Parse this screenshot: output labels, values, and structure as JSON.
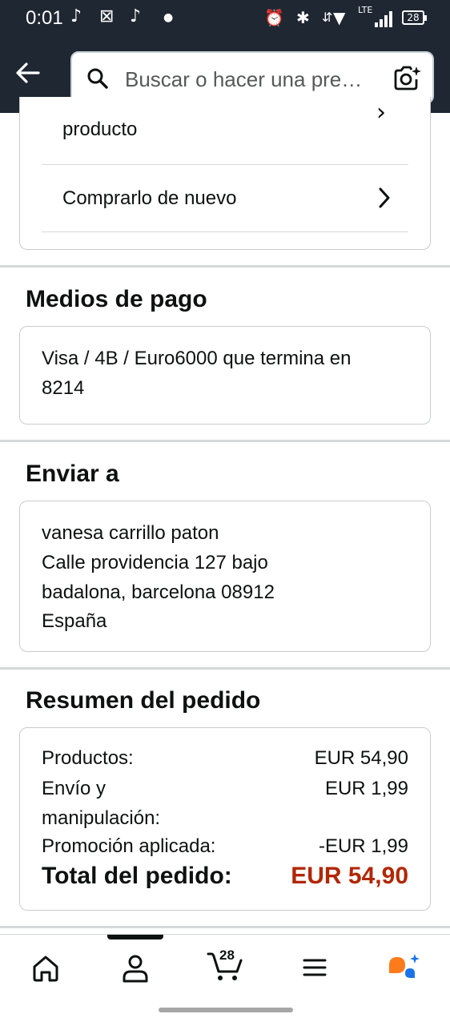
{
  "status_bar": {
    "time": "0:01",
    "network": "LTE",
    "battery": "28"
  },
  "search": {
    "placeholder": "Buscar o hacer una pre…"
  },
  "order_actions": {
    "partial_item_label": "producto",
    "buy_again_label": "Comprarlo de nuevo"
  },
  "payment": {
    "title": "Medios de pago",
    "method_line1": "Visa / 4B / Euro6000 que termina en",
    "method_line2": "8214"
  },
  "shipping": {
    "title": "Enviar a",
    "name": "vanesa carrillo paton",
    "street": "Calle providencia 127 bajo",
    "city": "badalona, barcelona 08912",
    "country": "España"
  },
  "summary": {
    "title": "Resumen del pedido",
    "products_label": "Productos:",
    "products_value": "EUR 54,90",
    "shipping_label_1": "Envío y",
    "shipping_label_2": "manipulación:",
    "shipping_value": "EUR 1,99",
    "promo_label": "Promoción aplicada:",
    "promo_value": "-EUR 1,99",
    "total_label": "Total del pedido:",
    "total_value": "EUR 54,90",
    "total_color": "#B12704"
  },
  "bottom_nav": {
    "cart_count": "28",
    "items": [
      "home-icon",
      "account-icon",
      "cart-icon",
      "menu-icon",
      "rufus-icon"
    ]
  }
}
